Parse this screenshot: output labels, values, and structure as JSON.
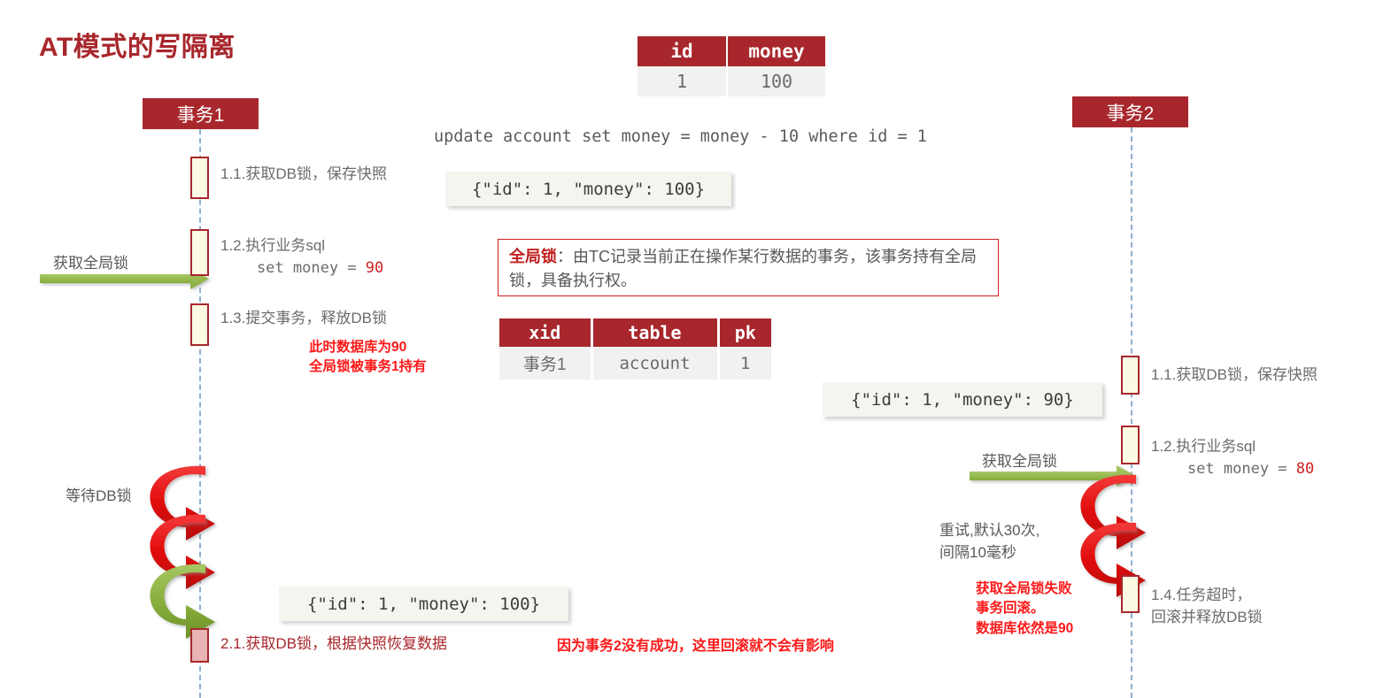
{
  "page_title": "AT模式的写隔离",
  "colors": {
    "brand_red": "#A8272C",
    "bright_red": "#FE1818",
    "green_arrow": "#8CB03C",
    "spiral_red": "#EE1111",
    "lifeline_blue": "#8EAFD0",
    "activation_fill": "#FBFBE4",
    "rollback_fill": "#E8B4B4",
    "json_bg": "#F2F6EF"
  },
  "actors": {
    "left": "事务1",
    "right": "事务2"
  },
  "sql_line": "update account set money = money - 10 where id = 1",
  "account_table": {
    "headers": [
      "id",
      "money"
    ],
    "rows": [
      [
        "1",
        "100"
      ]
    ]
  },
  "lock_table": {
    "headers": [
      "xid",
      "table",
      "pk"
    ],
    "rows": [
      [
        "事务1",
        "account",
        "1"
      ]
    ]
  },
  "global_lock_note": {
    "term": "全局锁",
    "body": "：由TC记录当前正在操作某行数据的事务，该事务持有全局锁，具备执行权。"
  },
  "left_steps": {
    "s1_1": "1.1.获取DB锁，保存快照",
    "s1_2_line1": "1.2.执行业务sql",
    "s1_2_line2": "    set money = ",
    "s1_2_value": "90",
    "s1_3": "1.3.提交事务，释放DB锁",
    "s2_1": "2.1.获取DB锁，根据快照恢复数据"
  },
  "right_steps": {
    "s1_1": "1.1.获取DB锁，保存快照",
    "s1_2_line1": "1.2.执行业务sql",
    "s1_2_line2": "    set money = ",
    "s1_2_value": "80",
    "s1_4_line1": "1.4.任务超时，",
    "s1_4_line2": "回滚并释放DB锁"
  },
  "side_labels": {
    "left_get_global_lock": "获取全局锁",
    "left_wait_db_lock": "等待DB锁",
    "right_get_global_lock": "获取全局锁",
    "right_retry": "重试,默认30次,\n间隔10毫秒"
  },
  "notes": {
    "left_db_state": "此时数据库为90\n全局锁被事务1持有",
    "right_rollback": "获取全局锁失败\n事务回滚。\n数据库依然是90",
    "bottom_no_effect": "因为事务2没有成功，这里回滚就不会有影响"
  },
  "snapshots": {
    "tx1_before": "{\"id\": 1, \"money\": 100}",
    "tx2_before": "{\"id\": 1, \"money\": 90}",
    "tx1_restore": "{\"id\": 1, \"money\": 100}"
  },
  "arrows": {
    "left_green_lock": "获取全局锁 arrow (green, rightward)",
    "right_green_lock": "获取全局锁 arrow (green, rightward)",
    "left_spirals": [
      "red-retry-spiral",
      "red-retry-spiral",
      "green-success-spiral"
    ],
    "right_spirals": [
      "red-retry-spiral",
      "red-retry-spiral"
    ]
  }
}
